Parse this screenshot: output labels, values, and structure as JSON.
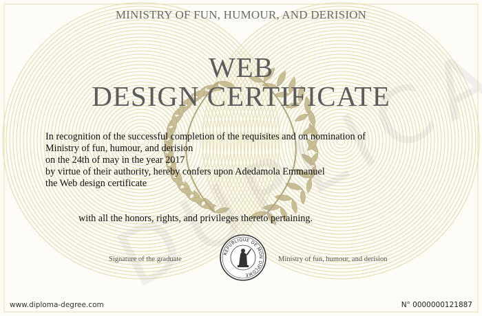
{
  "certificate": {
    "issuer_header": "MINISTRY OF FUN, HUMOUR, AND DERISION",
    "title_line1": "WEB",
    "title_line2": "DESIGN CERTIFICATE",
    "body_lines": [
      "In recognition of the successful completion of the requisites and on nomination of",
      "Ministry of fun, humour, and derision",
      "on the 24th of may in the year 2017",
      "by virtue of their authority, hereby confers upon Adedamola Emmanuel",
      "the Web design certificate"
    ],
    "honors_line": "with all the honors, rights, and privileges thereto pertaining.",
    "signature_graduate_label": "Signature of the graduate",
    "signature_ministry_label": "Ministry of fun, humour, and derision",
    "seal_text": "REPUBLIQUE DE MON DIPLOME",
    "website": "www.diploma-degree.com",
    "serial": "N° 0000000121887",
    "watermark": "DUPLICA"
  },
  "colors": {
    "guilloche": "#e6dcb0",
    "laurel": "#c9bd95",
    "title": "#5c5c5c",
    "text": "#111111"
  }
}
